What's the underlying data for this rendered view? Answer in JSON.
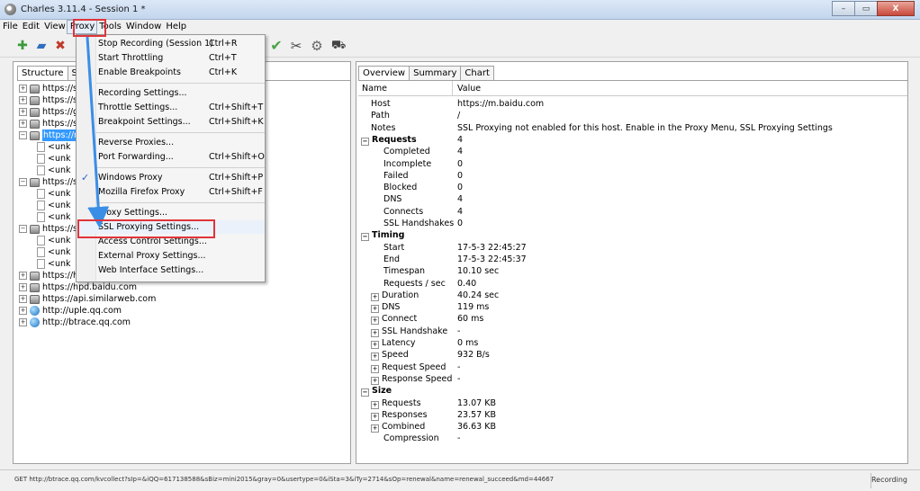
{
  "window": {
    "title": "Charles 3.11.4 - Session 1 *",
    "controls": [
      "–",
      "▭",
      "X"
    ]
  },
  "menubar": {
    "items": [
      "File",
      "Edit",
      "View",
      "Proxy",
      "Tools",
      "Window",
      "Help"
    ],
    "active": "Proxy"
  },
  "toolbar": {
    "icons": [
      "new-session-icon",
      "open-icon",
      "clear-icon",
      "check-icon",
      "tools-icon",
      "settings-gear-icon",
      "cart-icon"
    ]
  },
  "left_panel": {
    "tabs": [
      "Structure",
      "Seq"
    ],
    "tree": [
      {
        "label": "https://s",
        "icon": "lock",
        "level": 0,
        "expander": "+"
      },
      {
        "label": "https://s",
        "icon": "lock",
        "level": 0,
        "expander": "+"
      },
      {
        "label": "https://g",
        "icon": "lock",
        "level": 0,
        "expander": "+"
      },
      {
        "label": "https://s",
        "icon": "lock",
        "level": 0,
        "expander": "+"
      },
      {
        "label": "https://m",
        "icon": "lock",
        "level": 0,
        "expander": "−",
        "selected": true
      },
      {
        "label": "<unk",
        "icon": "doc",
        "level": 1
      },
      {
        "label": "<unk",
        "icon": "doc",
        "level": 1
      },
      {
        "label": "<unk",
        "icon": "doc",
        "level": 1
      },
      {
        "label": "https://s",
        "icon": "lock",
        "level": 0,
        "expander": "−"
      },
      {
        "label": "<unk",
        "icon": "doc",
        "level": 1
      },
      {
        "label": "<unk",
        "icon": "doc",
        "level": 1
      },
      {
        "label": "<unk",
        "icon": "doc",
        "level": 1
      },
      {
        "label": "https://s",
        "icon": "lock",
        "level": 0,
        "expander": "−"
      },
      {
        "label": "<unk",
        "icon": "doc",
        "level": 1
      },
      {
        "label": "<unk",
        "icon": "doc",
        "level": 1
      },
      {
        "label": "<unk",
        "icon": "doc",
        "level": 1
      },
      {
        "label": "https://hm.baidu.com",
        "icon": "lock",
        "level": 0,
        "expander": "+"
      },
      {
        "label": "https://hpd.baidu.com",
        "icon": "lock",
        "level": 0,
        "expander": "+"
      },
      {
        "label": "https://api.similarweb.com",
        "icon": "lock",
        "level": 0,
        "expander": "+"
      },
      {
        "label": "http://uple.qq.com",
        "icon": "globe",
        "level": 0,
        "expander": "+"
      },
      {
        "label": "http://btrace.qq.com",
        "icon": "globe",
        "level": 0,
        "expander": "+"
      }
    ]
  },
  "proxy_menu": {
    "items": [
      {
        "label": "Stop Recording (Session 1)",
        "shortcut": "Ctrl+R"
      },
      {
        "label": "Start Throttling",
        "shortcut": "Ctrl+T"
      },
      {
        "label": "Enable Breakpoints",
        "shortcut": "Ctrl+K"
      },
      {
        "sep": true
      },
      {
        "label": "Recording Settings...",
        "shortcut": ""
      },
      {
        "label": "Throttle Settings...",
        "shortcut": "Ctrl+Shift+T"
      },
      {
        "label": "Breakpoint Settings...",
        "shortcut": "Ctrl+Shift+K"
      },
      {
        "sep": true
      },
      {
        "label": "Reverse Proxies...",
        "shortcut": ""
      },
      {
        "label": "Port Forwarding...",
        "shortcut": "Ctrl+Shift+O"
      },
      {
        "sep": true
      },
      {
        "label": "Windows Proxy",
        "shortcut": "Ctrl+Shift+P",
        "checked": true
      },
      {
        "label": "Mozilla Firefox Proxy",
        "shortcut": "Ctrl+Shift+F"
      },
      {
        "sep": true
      },
      {
        "label": "Proxy Settings...",
        "shortcut": ""
      },
      {
        "label": "SSL Proxying Settings...",
        "shortcut": "",
        "highlight": true
      },
      {
        "label": "Access Control Settings...",
        "shortcut": ""
      },
      {
        "label": "External Proxy Settings...",
        "shortcut": ""
      },
      {
        "label": "Web Interface Settings...",
        "shortcut": ""
      }
    ]
  },
  "right_panel": {
    "tabs": [
      "Overview",
      "Summary",
      "Chart"
    ],
    "header": {
      "name": "Name",
      "value": "Value"
    },
    "rows": [
      {
        "name": "Host",
        "value": "https://m.baidu.com",
        "indent": 1
      },
      {
        "name": "Path",
        "value": "/",
        "indent": 1
      },
      {
        "name": "Notes",
        "value": "SSL Proxying not enabled for this host. Enable in the Proxy Menu, SSL Proxying Settings",
        "indent": 1
      },
      {
        "name": "Requests",
        "value": "4",
        "indent": 0,
        "bold": true,
        "exp": "−"
      },
      {
        "name": "Completed",
        "value": "4",
        "indent": 2
      },
      {
        "name": "Incomplete",
        "value": "0",
        "indent": 2
      },
      {
        "name": "Failed",
        "value": "0",
        "indent": 2
      },
      {
        "name": "Blocked",
        "value": "0",
        "indent": 2
      },
      {
        "name": "DNS",
        "value": "4",
        "indent": 2
      },
      {
        "name": "Connects",
        "value": "4",
        "indent": 2
      },
      {
        "name": "SSL Handshakes",
        "value": "0",
        "indent": 2
      },
      {
        "name": "Timing",
        "value": "",
        "indent": 0,
        "bold": true,
        "exp": "−"
      },
      {
        "name": "Start",
        "value": "17-5-3 22:45:27",
        "indent": 2
      },
      {
        "name": "End",
        "value": "17-5-3 22:45:37",
        "indent": 2
      },
      {
        "name": "Timespan",
        "value": "10.10 sec",
        "indent": 2
      },
      {
        "name": "Requests / sec",
        "value": "0.40",
        "indent": 2
      },
      {
        "name": "Duration",
        "value": "40.24 sec",
        "indent": 1,
        "exp": "+"
      },
      {
        "name": "DNS",
        "value": "119 ms",
        "indent": 1,
        "exp": "+"
      },
      {
        "name": "Connect",
        "value": "60 ms",
        "indent": 1,
        "exp": "+"
      },
      {
        "name": "SSL Handshake",
        "value": "-",
        "indent": 1,
        "exp": "+"
      },
      {
        "name": "Latency",
        "value": "0 ms",
        "indent": 1,
        "exp": "+"
      },
      {
        "name": "Speed",
        "value": "932 B/s",
        "indent": 1,
        "exp": "+"
      },
      {
        "name": "Request Speed",
        "value": "-",
        "indent": 1,
        "exp": "+"
      },
      {
        "name": "Response Speed",
        "value": "-",
        "indent": 1,
        "exp": "+"
      },
      {
        "name": "Size",
        "value": "",
        "indent": 0,
        "bold": true,
        "exp": "−"
      },
      {
        "name": "Requests",
        "value": "13.07 KB",
        "indent": 1,
        "exp": "+"
      },
      {
        "name": "Responses",
        "value": "23.57 KB",
        "indent": 1,
        "exp": "+"
      },
      {
        "name": "Combined",
        "value": "36.63 KB",
        "indent": 1,
        "exp": "+"
      },
      {
        "name": "Compression",
        "value": "-",
        "indent": 2
      }
    ]
  },
  "statusbar": {
    "text": "GET http://btrace.qq.com/kvcollect?sIp=&iQQ=617138588&sBiz=mini2015&gray=0&usertype=0&iSta=3&iTy=2714&sOp=renewal&name=renewal_succeed&md=44667",
    "right": "Recording"
  },
  "colors": {
    "annotation": "#e0343a",
    "arrow": "#3a8ee6",
    "selection": "#3399ff"
  }
}
